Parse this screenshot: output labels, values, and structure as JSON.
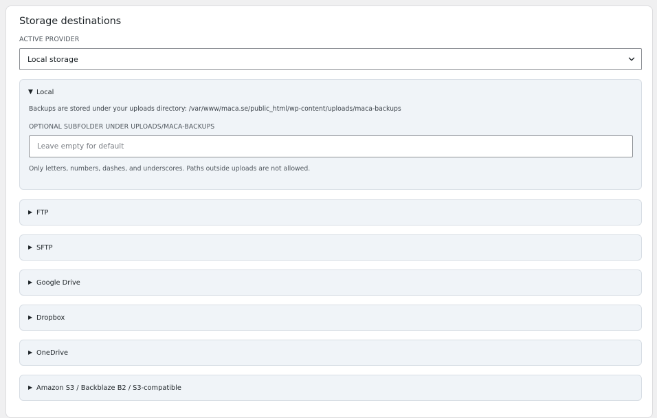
{
  "panel": {
    "title": "Storage destinations",
    "provider_label": "ACTIVE PROVIDER",
    "provider_selected": "Local storage"
  },
  "local": {
    "summary": "Local",
    "description": "Backups are stored under your uploads directory: /var/www/maca.se/public_html/wp-content/uploads/maca-backups",
    "subfolder_label": "OPTIONAL SUBFOLDER UNDER UPLOADS/MACA-BACKUPS",
    "subfolder_value": "",
    "subfolder_placeholder": "Leave empty for default",
    "help": "Only letters, numbers, dashes, and underscores. Paths outside uploads are not allowed."
  },
  "providers": [
    {
      "label": "FTP"
    },
    {
      "label": "SFTP"
    },
    {
      "label": "Google Drive"
    },
    {
      "label": "Dropbox"
    },
    {
      "label": "OneDrive"
    },
    {
      "label": "Amazon S3 / Backblaze B2 / S3-compatible"
    }
  ],
  "icons": {
    "expanded": "triangle-down-icon",
    "collapsed": "triangle-right-icon",
    "select": "chevron-down-icon"
  }
}
